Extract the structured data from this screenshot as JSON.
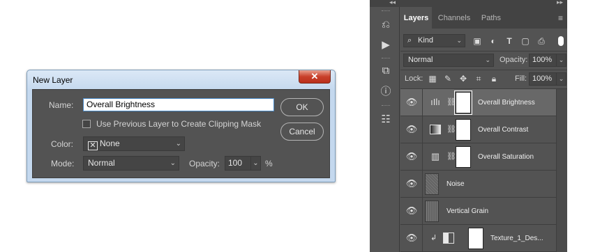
{
  "dialog": {
    "title": "New Layer",
    "close_glyph": "✕",
    "name_label": "Name:",
    "name_value": "Overall Brightness",
    "clip_checkbox_label": "Use Previous Layer to Create Clipping Mask",
    "clip_checked": false,
    "color_label": "Color:",
    "color_value": "None",
    "mode_label": "Mode:",
    "mode_value": "Normal",
    "opacity_label": "Opacity:",
    "opacity_value": "100",
    "opacity_unit": "%",
    "ok_label": "OK",
    "cancel_label": "Cancel"
  },
  "panel": {
    "collapse_left": "◂◂",
    "collapse_right": "▸▸",
    "tabs": [
      {
        "label": "Layers",
        "active": true
      },
      {
        "label": "Channels",
        "active": false
      },
      {
        "label": "Paths",
        "active": false
      }
    ],
    "filter_kind": "Kind",
    "filter_icons": [
      "image-filter-icon",
      "adjustment-filter-icon",
      "type-filter-icon",
      "shape-filter-icon",
      "smart-object-filter-icon"
    ],
    "blend_mode": "Normal",
    "opacity_label": "Opacity:",
    "opacity_value": "100%",
    "lock_label": "Lock:",
    "fill_label": "Fill:",
    "fill_value": "100%",
    "layers": [
      {
        "name": "Overall Brightness",
        "selected": true
      },
      {
        "name": "Overall Contrast",
        "selected": false
      },
      {
        "name": "Overall Saturation",
        "selected": false
      },
      {
        "name": "Noise",
        "selected": false
      },
      {
        "name": "Vertical Grain",
        "selected": false
      },
      {
        "name": "Texture_1_Des...",
        "selected": false
      }
    ]
  }
}
